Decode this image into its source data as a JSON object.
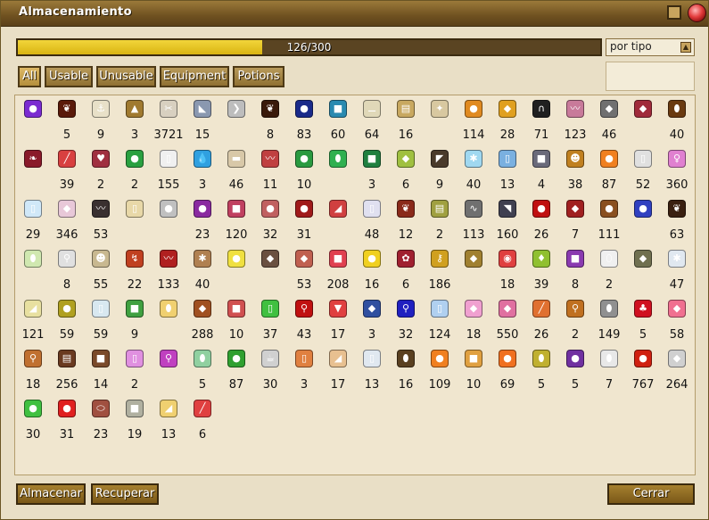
{
  "window": {
    "title": "Almacenamiento"
  },
  "storage": {
    "label": "126/300",
    "fraction": 0.42
  },
  "sort": {
    "label": "por tipo"
  },
  "filters": [
    "All",
    "Usable",
    "Unusable",
    "Equipment",
    "Potions"
  ],
  "items": [
    {
      "count": "",
      "color": "#7b2bd1",
      "icon": "●"
    },
    {
      "count": "5",
      "color": "#5a1a0a",
      "icon": "❦"
    },
    {
      "count": "9",
      "color": "#e8e0c8",
      "icon": "⚓"
    },
    {
      "count": "3",
      "color": "#a07a30",
      "icon": "▲"
    },
    {
      "count": "3721",
      "color": "#d8d0c0",
      "icon": "✂"
    },
    {
      "count": "15",
      "color": "#8a98b0",
      "icon": "◣"
    },
    {
      "count": "",
      "color": "#bdbdbd",
      "icon": "❯"
    },
    {
      "count": "8",
      "color": "#3a1a0a",
      "icon": "❦"
    },
    {
      "count": "83",
      "color": "#1a2a8a",
      "icon": "●"
    },
    {
      "count": "60",
      "color": "#2a8ab0",
      "icon": "■"
    },
    {
      "count": "64",
      "color": "#e0d8b8",
      "icon": "⚊"
    },
    {
      "count": "16",
      "color": "#c8a860",
      "icon": "▤"
    },
    {
      "count": "",
      "color": "#d8c8a0",
      "icon": "✦"
    },
    {
      "count": "114",
      "color": "#e08a20",
      "icon": "●"
    },
    {
      "count": "28",
      "color": "#e0a020",
      "icon": "◆"
    },
    {
      "count": "71",
      "color": "#202020",
      "icon": "∩"
    },
    {
      "count": "123",
      "color": "#c87a9a",
      "icon": "〰"
    },
    {
      "count": "46",
      "color": "#707070",
      "icon": "◆"
    },
    {
      "count": "",
      "color": "#a02a3a",
      "icon": "◆"
    },
    {
      "count": "40",
      "color": "#6a3a10",
      "icon": "⬮"
    },
    {
      "count": "",
      "color": "#8a1a2a",
      "icon": "❧"
    },
    {
      "count": "39",
      "color": "#d84040",
      "icon": "╱"
    },
    {
      "count": "2",
      "color": "#a03040",
      "icon": "♥"
    },
    {
      "count": "2",
      "color": "#2aa040",
      "icon": "●"
    },
    {
      "count": "155",
      "color": "#f0f0f0",
      "icon": "▯"
    },
    {
      "count": "3",
      "color": "#30a0e0",
      "icon": "💧"
    },
    {
      "count": "46",
      "color": "#d8c8a8",
      "icon": "▬"
    },
    {
      "count": "11",
      "color": "#c04040",
      "icon": "〰"
    },
    {
      "count": "10",
      "color": "#2a9a40",
      "icon": "●"
    },
    {
      "count": "",
      "color": "#30b050",
      "icon": "⬮"
    },
    {
      "count": "3",
      "color": "#208040",
      "icon": "■"
    },
    {
      "count": "6",
      "color": "#a0c040",
      "icon": "◆"
    },
    {
      "count": "9",
      "color": "#4a3a2a",
      "icon": "◤"
    },
    {
      "count": "40",
      "color": "#a0d8f0",
      "icon": "✱"
    },
    {
      "count": "13",
      "color": "#7ab0e0",
      "icon": "▯"
    },
    {
      "count": "4",
      "color": "#6a6a7a",
      "icon": "■"
    },
    {
      "count": "38",
      "color": "#c08020",
      "icon": "☻"
    },
    {
      "count": "87",
      "color": "#f08020",
      "icon": "●"
    },
    {
      "count": "52",
      "color": "#e0e0e0",
      "icon": "▯"
    },
    {
      "count": "360",
      "color": "#e080d0",
      "icon": "♀"
    },
    {
      "count": "29",
      "color": "#d0e8f8",
      "icon": "▯"
    },
    {
      "count": "346",
      "color": "#e8c8d8",
      "icon": "◆"
    },
    {
      "count": "53",
      "color": "#3a3030",
      "icon": "〰"
    },
    {
      "count": "",
      "color": "#e8d8a8",
      "icon": "▯"
    },
    {
      "count": "",
      "color": "#c0c0c0",
      "icon": "●"
    },
    {
      "count": "23",
      "color": "#8a2aa0",
      "icon": "●"
    },
    {
      "count": "120",
      "color": "#c04060",
      "icon": "■"
    },
    {
      "count": "32",
      "color": "#c06060",
      "icon": "●"
    },
    {
      "count": "31",
      "color": "#a01a1a",
      "icon": "●"
    },
    {
      "count": "",
      "color": "#d04040",
      "icon": "◢"
    },
    {
      "count": "48",
      "color": "#e0e0f0",
      "icon": "▯"
    },
    {
      "count": "12",
      "color": "#8a2a1a",
      "icon": "❦"
    },
    {
      "count": "2",
      "color": "#a0a040",
      "icon": "▤"
    },
    {
      "count": "113",
      "color": "#707070",
      "icon": "∿"
    },
    {
      "count": "160",
      "color": "#404050",
      "icon": "◥"
    },
    {
      "count": "26",
      "color": "#c01010",
      "icon": "●"
    },
    {
      "count": "7",
      "color": "#a02020",
      "icon": "◆"
    },
    {
      "count": "111",
      "color": "#8a5020",
      "icon": "●"
    },
    {
      "count": "",
      "color": "#3040c0",
      "icon": "●"
    },
    {
      "count": "63",
      "color": "#3a2010",
      "icon": "❦"
    },
    {
      "count": "",
      "color": "#d0e8b0",
      "icon": "⬮"
    },
    {
      "count": "8",
      "color": "#e0e0e0",
      "icon": "⚲"
    },
    {
      "count": "55",
      "color": "#c8b890",
      "icon": "☻"
    },
    {
      "count": "22",
      "color": "#c04020",
      "icon": "↯"
    },
    {
      "count": "133",
      "color": "#b02020",
      "icon": "〰"
    },
    {
      "count": "40",
      "color": "#b08050",
      "icon": "✱"
    },
    {
      "count": "",
      "color": "#f0e040",
      "icon": "●"
    },
    {
      "count": "",
      "color": "#6a5040",
      "icon": "◆"
    },
    {
      "count": "53",
      "color": "#c06050",
      "icon": "◆"
    },
    {
      "count": "208",
      "color": "#e04050",
      "icon": "■"
    },
    {
      "count": "16",
      "color": "#f0d020",
      "icon": "●"
    },
    {
      "count": "6",
      "color": "#a02030",
      "icon": "✿"
    },
    {
      "count": "186",
      "color": "#d0a020",
      "icon": "⚷"
    },
    {
      "count": "",
      "color": "#a08030",
      "icon": "◆"
    },
    {
      "count": "18",
      "color": "#e04040",
      "icon": "◉"
    },
    {
      "count": "39",
      "color": "#90c030",
      "icon": "♦"
    },
    {
      "count": "8",
      "color": "#8a3ab0",
      "icon": "■"
    },
    {
      "count": "2",
      "color": "#f0f0f0",
      "icon": "⬯"
    },
    {
      "count": "",
      "color": "#707050",
      "icon": "◆"
    },
    {
      "count": "47",
      "color": "#e0e8f0",
      "icon": "✱"
    },
    {
      "count": "121",
      "color": "#e8e0a0",
      "icon": "◢"
    },
    {
      "count": "59",
      "color": "#b0a020",
      "icon": "●"
    },
    {
      "count": "59",
      "color": "#d8e8f0",
      "icon": "▯"
    },
    {
      "count": "9",
      "color": "#40a040",
      "icon": "■"
    },
    {
      "count": "",
      "color": "#f0d070",
      "icon": "⬮"
    },
    {
      "count": "288",
      "color": "#a05020",
      "icon": "◆"
    },
    {
      "count": "10",
      "color": "#d05050",
      "icon": "■"
    },
    {
      "count": "37",
      "color": "#40c040",
      "icon": "▯"
    },
    {
      "count": "43",
      "color": "#c01010",
      "icon": "⚲"
    },
    {
      "count": "17",
      "color": "#e04040",
      "icon": "▼"
    },
    {
      "count": "3",
      "color": "#3050a0",
      "icon": "◆"
    },
    {
      "count": "32",
      "color": "#2020c0",
      "icon": "⚲"
    },
    {
      "count": "124",
      "color": "#b0d0f0",
      "icon": "▯"
    },
    {
      "count": "18",
      "color": "#f0a0d0",
      "icon": "◆"
    },
    {
      "count": "550",
      "color": "#e070a0",
      "icon": "◆"
    },
    {
      "count": "26",
      "color": "#e07030",
      "icon": "╱"
    },
    {
      "count": "2",
      "color": "#c07020",
      "icon": "⚲"
    },
    {
      "count": "149",
      "color": "#909090",
      "icon": "⬮"
    },
    {
      "count": "5",
      "color": "#d01020",
      "icon": "♣"
    },
    {
      "count": "58",
      "color": "#f07090",
      "icon": "◆"
    },
    {
      "count": "18",
      "color": "#c07030",
      "icon": "⚲"
    },
    {
      "count": "256",
      "color": "#6a3a20",
      "icon": "▤"
    },
    {
      "count": "14",
      "color": "#7a4a2a",
      "icon": "■"
    },
    {
      "count": "2",
      "color": "#e090e0",
      "icon": "▯"
    },
    {
      "count": "",
      "color": "#c040c0",
      "icon": "⚲"
    },
    {
      "count": "5",
      "color": "#90d0a0",
      "icon": "⬮"
    },
    {
      "count": "87",
      "color": "#30a030",
      "icon": "●"
    },
    {
      "count": "30",
      "color": "#d0d0d0",
      "icon": "☕"
    },
    {
      "count": "3",
      "color": "#e08040",
      "icon": "▯"
    },
    {
      "count": "17",
      "color": "#e8c090",
      "icon": "◢"
    },
    {
      "count": "13",
      "color": "#e0e8f0",
      "icon": "▯"
    },
    {
      "count": "16",
      "color": "#5a4020",
      "icon": "⬮"
    },
    {
      "count": "109",
      "color": "#f08020",
      "icon": "●"
    },
    {
      "count": "10",
      "color": "#e0a040",
      "icon": "■"
    },
    {
      "count": "69",
      "color": "#f07020",
      "icon": "●"
    },
    {
      "count": "5",
      "color": "#c0b030",
      "icon": "⬮"
    },
    {
      "count": "5",
      "color": "#7030a0",
      "icon": "●"
    },
    {
      "count": "7",
      "color": "#e8e8e8",
      "icon": "⬮"
    },
    {
      "count": "767",
      "color": "#d02010",
      "icon": "●"
    },
    {
      "count": "264",
      "color": "#d0d0d0",
      "icon": "◆"
    },
    {
      "count": "30",
      "color": "#40c040",
      "icon": "●"
    },
    {
      "count": "31",
      "color": "#e02020",
      "icon": "●"
    },
    {
      "count": "23",
      "color": "#a05040",
      "icon": "⬭"
    },
    {
      "count": "19",
      "color": "#b0b0a0",
      "icon": "■"
    },
    {
      "count": "13",
      "color": "#f0d070",
      "icon": "◢"
    },
    {
      "count": "6",
      "color": "#e04040",
      "icon": "╱"
    }
  ],
  "buttons": {
    "store": "Almacenar",
    "retrieve": "Recuperar",
    "close": "Cerrar"
  }
}
